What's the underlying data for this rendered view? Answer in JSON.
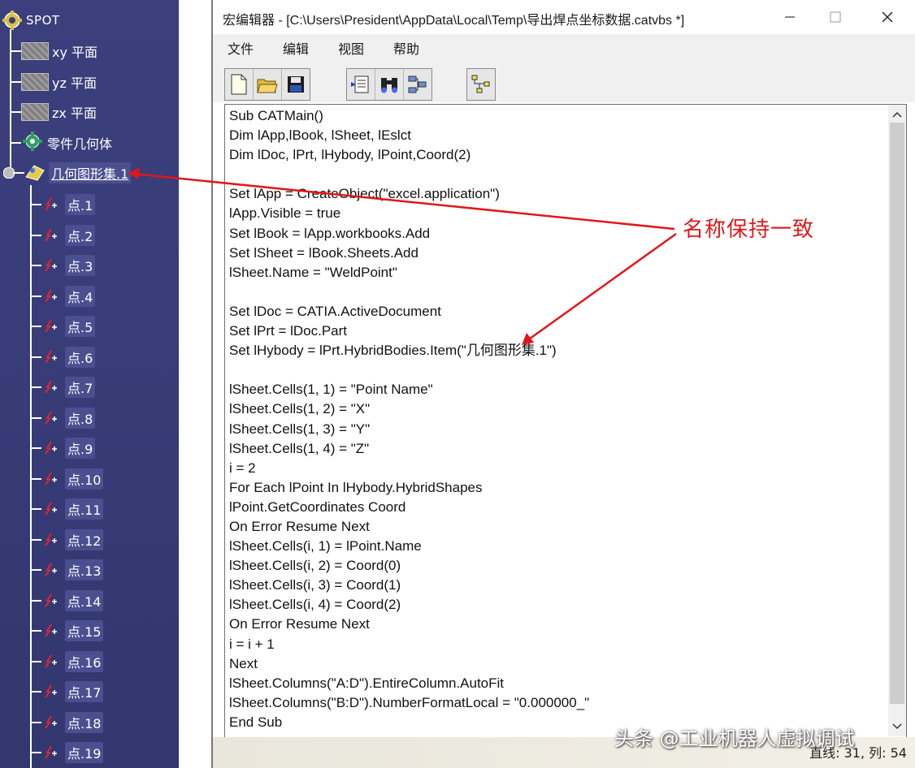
{
  "tree": {
    "root": "SPOT",
    "planes": [
      "xy 平面",
      "yz 平面",
      "zx 平面"
    ],
    "part_body": "零件几何体",
    "geo_set": "几何图形集.1",
    "points": [
      "点.1",
      "点.2",
      "点.3",
      "点.4",
      "点.5",
      "点.6",
      "点.7",
      "点.8",
      "点.9",
      "点.10",
      "点.11",
      "点.12",
      "点.13",
      "点.14",
      "点.15",
      "点.16",
      "点.17",
      "点.18",
      "点.19"
    ]
  },
  "window": {
    "title": "宏编辑器 - [C:\\Users\\President\\AppData\\Local\\Temp\\导出焊点坐标数据.catvbs *]",
    "menu": [
      "文件",
      "编辑",
      "视图",
      "帮助"
    ],
    "status": "直线: 31, 列: 54"
  },
  "code_lines": [
    "Sub CATMain()",
    "Dim lApp,lBook, lSheet, lEslct",
    "Dim lDoc, lPrt, lHybody, lPoint,Coord(2)",
    "",
    "Set lApp = CreateObject(\"excel.application\")",
    "lApp.Visible = true",
    "Set lBook = lApp.workbooks.Add",
    "Set lSheet = lBook.Sheets.Add",
    "lSheet.Name = \"WeldPoint\"",
    "",
    "Set lDoc = CATIA.ActiveDocument",
    "Set lPrt = lDoc.Part",
    "Set lHybody = lPrt.HybridBodies.Item(\"几何图形集.1\")",
    "",
    "lSheet.Cells(1, 1) = \"Point Name\"",
    "lSheet.Cells(1, 2) = \"X\"",
    "lSheet.Cells(1, 3) = \"Y\"",
    "lSheet.Cells(1, 4) = \"Z\"",
    "i = 2",
    "For Each lPoint In lHybody.HybridShapes",
    "lPoint.GetCoordinates Coord",
    "On Error Resume Next",
    "lSheet.Cells(i, 1) = lPoint.Name",
    "lSheet.Cells(i, 2) = Coord(0)",
    "lSheet.Cells(i, 3) = Coord(1)",
    "lSheet.Cells(i, 4) = Coord(2)",
    "On Error Resume Next",
    "i = i + 1",
    "Next",
    "lSheet.Columns(\"A:D\").EntireColumn.AutoFit",
    "lSheet.Columns(\"B:D\").NumberFormatLocal = \"0.000000_\"",
    "End Sub"
  ],
  "annotation": "名称保持一致",
  "watermark": "头条 @工业机器人虚拟调试",
  "colors": {
    "annotation": "#e0171a",
    "tree_bg": "#3b3f7c"
  }
}
